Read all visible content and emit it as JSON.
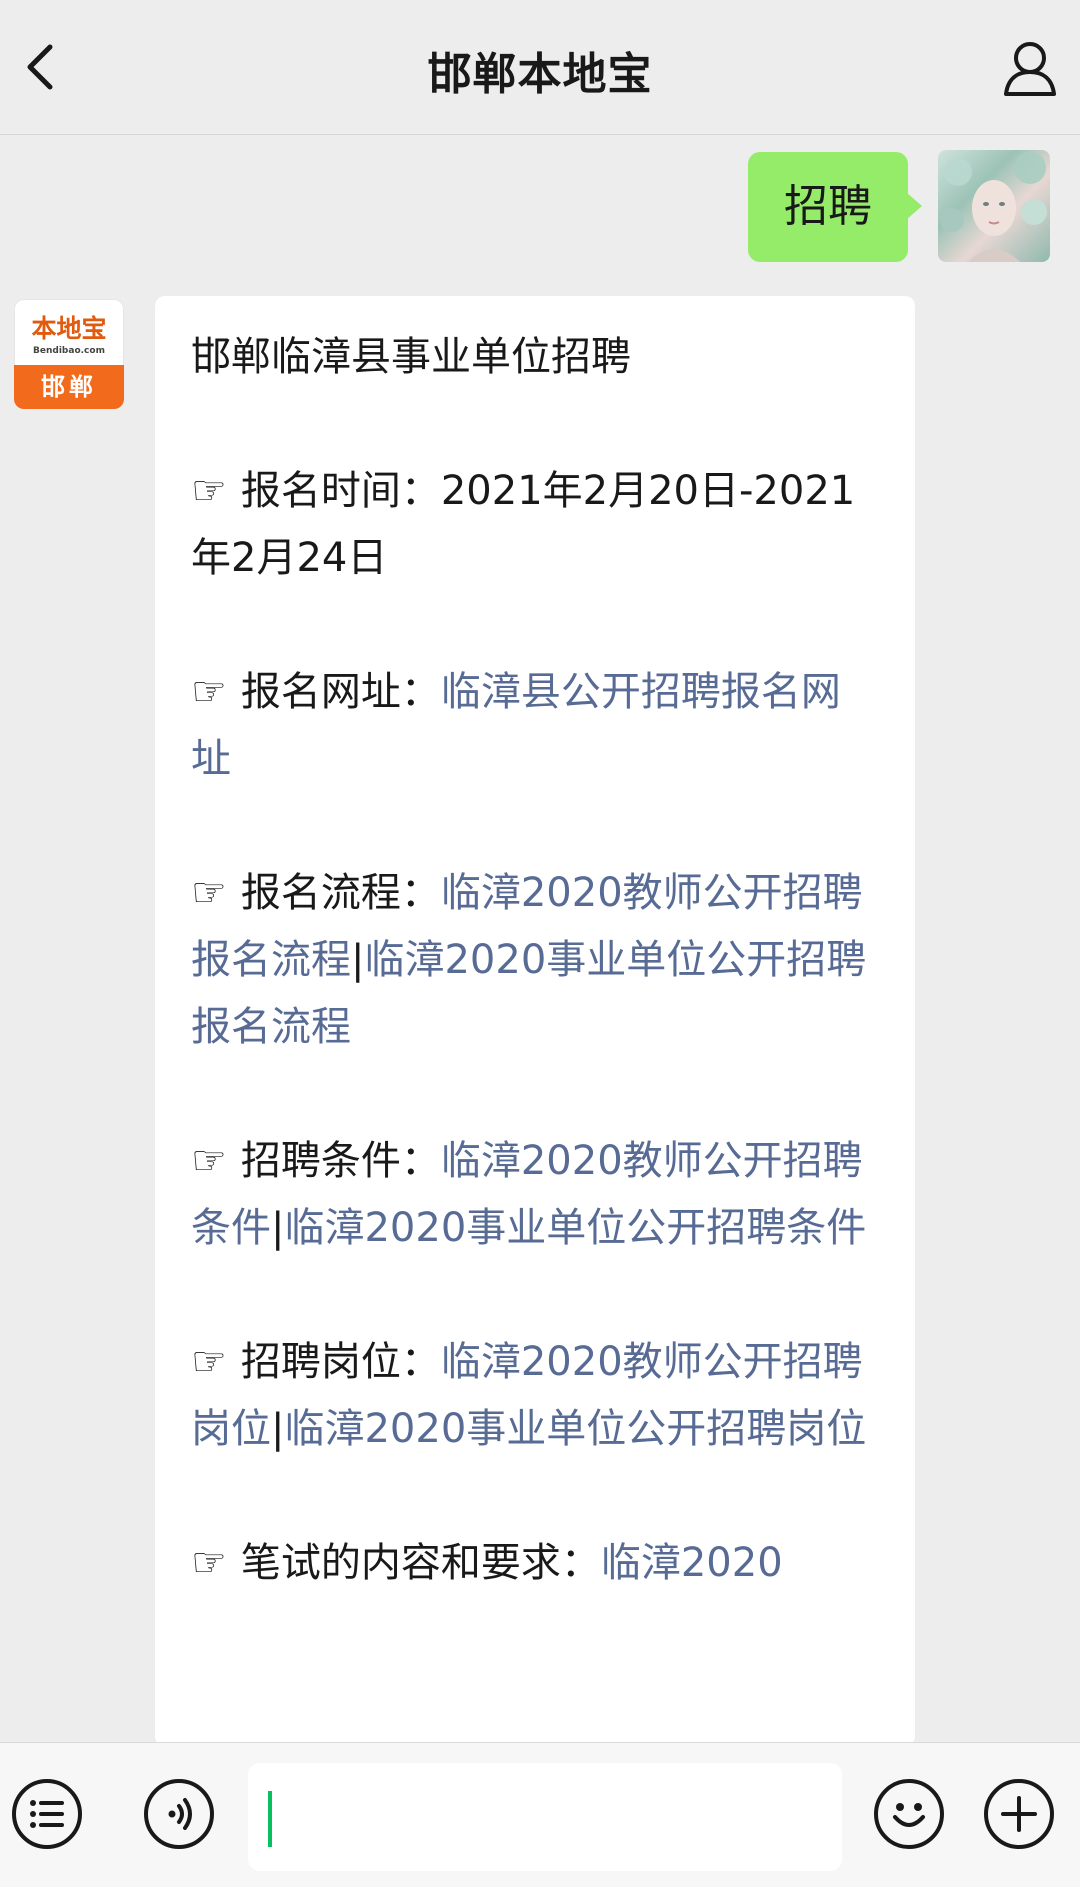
{
  "header": {
    "title": "邯郸本地宝",
    "back_icon": "chevron-left-icon",
    "profile_icon": "person-icon"
  },
  "outgoing": {
    "text": "招聘"
  },
  "incoming": {
    "avatar": {
      "line1": "本地宝",
      "line2": "Bendibao.com",
      "line3": "邯郸"
    },
    "title": "邯郸临漳县事业单位招聘",
    "items": [
      {
        "hand": "☞",
        "label": "报名时间：",
        "text": "2021年2月20日-2021年2月24日"
      },
      {
        "hand": "☞",
        "label": "报名网址：",
        "link": "临漳县公开招聘报名网址"
      },
      {
        "hand": "☞",
        "label": "报名流程：",
        "link1": "临漳2020教师公开招聘报名流程",
        "sep": "|",
        "link2": "临漳2020事业单位公开招聘报名流程"
      },
      {
        "hand": "☞",
        "label": "招聘条件：",
        "link1": "临漳2020教师公开招聘条件",
        "sep": "|",
        "link2": "临漳2020事业单位公开招聘条件"
      },
      {
        "hand": "☞",
        "label": "招聘岗位：",
        "link1": "临漳2020教师公开招聘岗位",
        "sep": "|",
        "link2": "临漳2020事业单位公开招聘岗位"
      },
      {
        "hand": "☞",
        "label": "笔试的内容和要求：",
        "link": "临漳2020"
      }
    ]
  },
  "input_bar": {
    "menu_icon": "menu-list-icon",
    "voice_icon": "voice-icon",
    "emoji_icon": "emoji-icon",
    "plus_icon": "plus-icon",
    "value": ""
  },
  "colors": {
    "background": "#ededed",
    "bubble_out": "#95ec69",
    "link": "#576b95",
    "brand": "#f26b1d"
  }
}
